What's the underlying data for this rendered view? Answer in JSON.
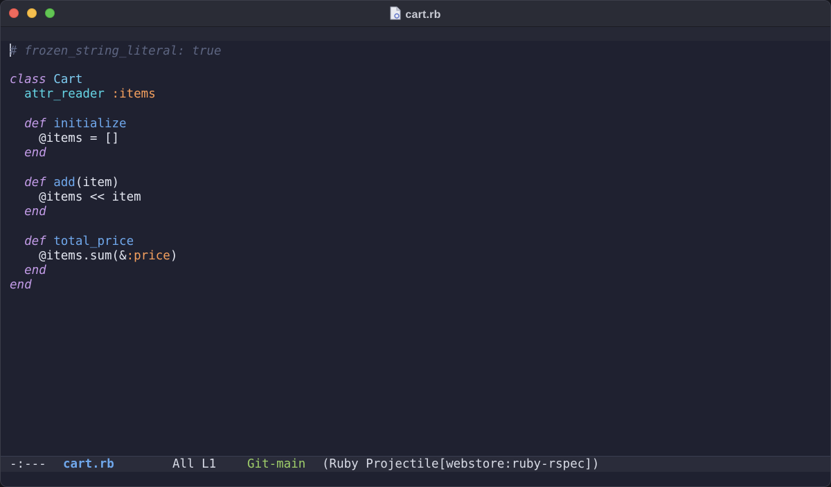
{
  "window": {
    "title": "cart.rb",
    "title_icon": "ruby-file-icon"
  },
  "editor": {
    "lines": {
      "l1": {
        "comment": "# frozen_string_literal: true"
      },
      "l3": {
        "kw": "class",
        "name": "Cart"
      },
      "l4": {
        "method": "attr_reader",
        "symbol": ":items"
      },
      "l6": {
        "kw": "def",
        "name": "initialize"
      },
      "l7": {
        "text": "@items = []"
      },
      "l8": {
        "kw": "end"
      },
      "l10": {
        "kw": "def",
        "name": "add",
        "args": "(item)"
      },
      "l11": {
        "text": "@items << item"
      },
      "l12": {
        "kw": "end"
      },
      "l14": {
        "kw": "def",
        "name": "total_price"
      },
      "l15": {
        "pre": "@items.sum(&",
        "symbol": ":price",
        "post": ")"
      },
      "l16": {
        "kw": "end"
      },
      "l17": {
        "kw": "end"
      }
    }
  },
  "modeline": {
    "status": "-:---",
    "buffer": "cart.rb",
    "position": "All L1",
    "vc": "Git-main",
    "modes": "(Ruby Projectile[webstore:ruby-rspec])"
  },
  "colors": {
    "background": "#1f2130",
    "comment": "#5d6581",
    "keyword": "#c39ce8",
    "function": "#70a8ec",
    "symbol": "#f4a05e",
    "git": "#9fce6a"
  }
}
